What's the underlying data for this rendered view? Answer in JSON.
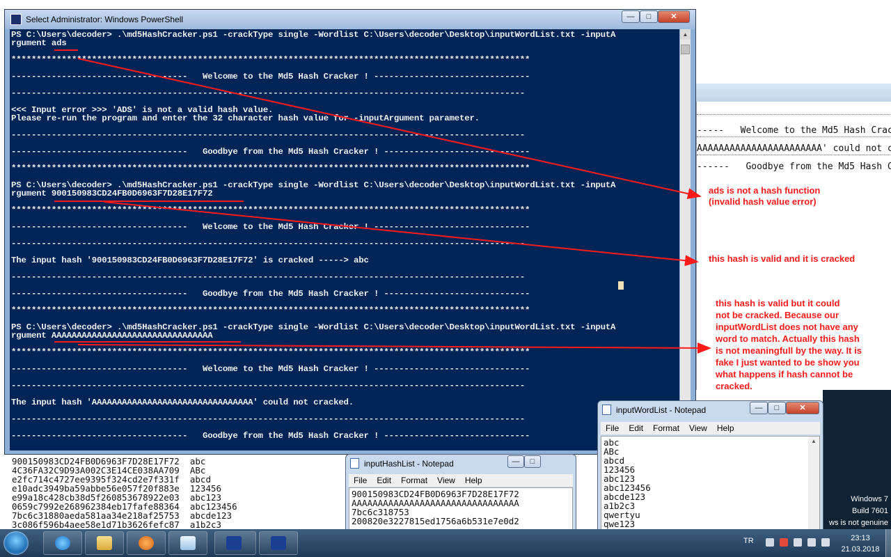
{
  "powershell": {
    "title": "Select Administrator: Windows PowerShell",
    "lines": [
      "PS C:\\Users\\decoder> .\\md5HashCracker.ps1 -crackType single -Wordlist C:\\Users\\decoder\\Desktop\\inputWordList.txt -inputA",
      "rgument ads",
      "",
      "*******************************************************************************************************",
      "",
      "-----------------------------------   Welcome to the Md5 Hash Cracker ! -------------------------------",
      "",
      "------------------------------------------------------------------------------------------------------",
      "",
      "<<< Input error >>> 'ADS' is not a valid hash value.",
      "Please re-run the program and enter the 32 character hash value for -inputArgument parameter.",
      "",
      "------------------------------------------------------------------------------------------------------",
      "",
      "-----------------------------------   Goodbye from the Md5 Hash Cracker ! -----------------------------",
      "",
      "*******************************************************************************************************",
      "",
      "PS C:\\Users\\decoder> .\\md5HashCracker.ps1 -crackType single -Wordlist C:\\Users\\decoder\\Desktop\\inputWordList.txt -inputA",
      "rgument 900150983CD24FB0D6963F7D28E17F72",
      "",
      "*******************************************************************************************************",
      "",
      "-----------------------------------   Welcome to the Md5 Hash Cracker ! -------------------------------",
      "",
      "------------------------------------------------------------------------------------------------------",
      "",
      "The input hash '900150983CD24FB0D6963F7D28E17F72' is cracked -----> abc",
      "",
      "------------------------------------------------------------------------------------------------------",
      "",
      "-----------------------------------   Goodbye from the Md5 Hash Cracker ! -----------------------------",
      "",
      "*******************************************************************************************************",
      "",
      "PS C:\\Users\\decoder> .\\md5HashCracker.ps1 -crackType single -Wordlist C:\\Users\\decoder\\Desktop\\inputWordList.txt -inputA",
      "rgument AAAAAAAAAAAAAAAAAAAAAAAAAAAAAAAA",
      "",
      "*******************************************************************************************************",
      "",
      "-----------------------------------   Welcome to the Md5 Hash Cracker ! -------------------------------",
      "",
      "------------------------------------------------------------------------------------------------------",
      "",
      "The input hash 'AAAAAAAAAAAAAAAAAAAAAAAAAAAAAAAA' could not cracked.",
      "",
      "------------------------------------------------------------------------------------------------------",
      "",
      "-----------------------------------   Goodbye from the Md5 Hash Cracker ! -----------------------------"
    ]
  },
  "background_window": {
    "lines": [
      "-----   Welcome to the Md5 Hash Crac",
      "AAAAAAAAAAAAAAAAAAAAAAA' could not cr",
      "------   Goodbye from the Md5 Hash C"
    ]
  },
  "annotations": {
    "note1": [
      "ads is not a hash function",
      "(invalid hash value error)"
    ],
    "note2": [
      "this hash is valid and it is cracked"
    ],
    "note3": [
      "this hash is valid but it could",
      "not be cracked. Because our",
      "inputWordList does not have any",
      "word to match. Actually this hash",
      "is not meaningfull by the way. It is",
      "fake I just wanted to be show you",
      "what happens if hash cannot be",
      "cracked."
    ],
    "color": "#ff1a1a"
  },
  "hash_list_window": {
    "lines": [
      "900150983CD24FB0D6963F7D28E17F72  abc",
      "4C36FA32C9D93A002C3E14CE038AA709  ABc",
      "e2fc714c4727ee9395f324cd2e7f331f  abcd",
      "e10adc3949ba59abbe56e057f20f883e  123456",
      "e99a18c428cb38d5f260853678922e03  abc123",
      "0659c7992e268962384eb17fafe88364  abc123456",
      "7bc6c31880aeda581aa34e218af25753  abcde123",
      "3c086f596b4aee58e1d71b3626fefc87  a1b2c3"
    ]
  },
  "notepad_hash": {
    "title": "inputHashList - Notepad",
    "menu": [
      "File",
      "Edit",
      "Format",
      "View",
      "Help"
    ],
    "lines": [
      "900150983CD24FB0D6963F7D28E17F72",
      "AAAAAAAAAAAAAAAAAAAAAAAAAAAAAAAA",
      "7bc6c318753",
      "200820e3227815ed1756a6b531e7e0d2"
    ]
  },
  "notepad_word": {
    "title": "inputWordList - Notepad",
    "menu": [
      "File",
      "Edit",
      "Format",
      "View",
      "Help"
    ],
    "lines": [
      "abc",
      "ABc",
      "abcd",
      "123456",
      "abc123",
      "abc123456",
      "abcde123",
      "a1b2c3",
      "qwertyu",
      "qwe123"
    ]
  },
  "desktop_notice": {
    "line1": "Windows 7",
    "line2": "Build 7601",
    "line3": "ws is not genuine"
  },
  "taskbar": {
    "language": "TR",
    "time": "23:13",
    "date": "21.03.2018"
  },
  "colors": {
    "console_bg": "#012456",
    "console_text": "#eeedf0"
  }
}
